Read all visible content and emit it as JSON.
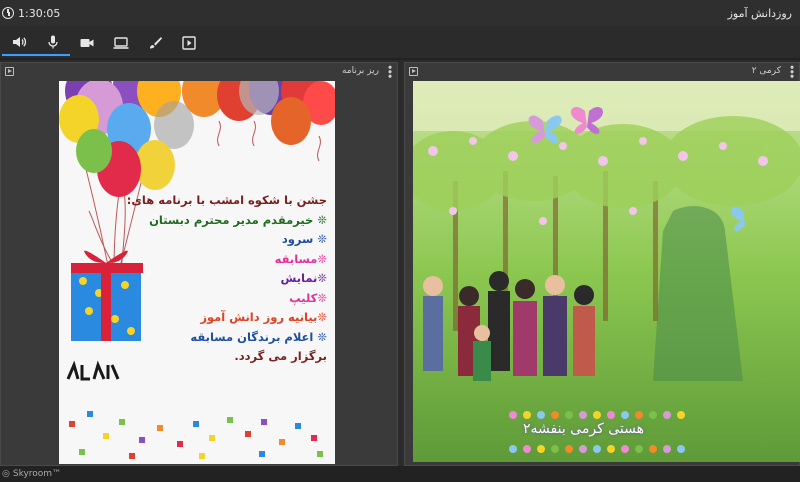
{
  "titlebar": {
    "timer": "1:30:05",
    "app_title": "روزدانش آموز"
  },
  "panels": {
    "left": {
      "title": "ریز برنامه"
    },
    "right": {
      "title": "کرمی ۲"
    }
  },
  "program": {
    "lines": [
      {
        "text": "جشن با شکوه امشب با برنامه های:",
        "color": "#7a1f1f"
      },
      {
        "text": "❊ خیرمقدم مدیر محترم دبستان",
        "color": "#1f6a1f"
      },
      {
        "text": "❊ سرود",
        "color": "#1f4fa0"
      },
      {
        "text": "❊مسابقه",
        "color": "#e0339a"
      },
      {
        "text": "❊نمایش",
        "color": "#6a1fa0"
      },
      {
        "text": "❊کلیپ",
        "color": "#e0339a"
      },
      {
        "text": "❊بیانیه روز دانش آموز",
        "color": "#e2401f"
      },
      {
        "text": "❊ اعلام برندگان مسابقه",
        "color": "#1f4fa0"
      },
      {
        "text": "برگزار می گردد.",
        "color": "#7a1f1f"
      }
    ]
  },
  "video": {
    "caption": "هستی کرمی بنفشه۲"
  },
  "footer": {
    "brand": "Skyroom™"
  },
  "colors": {
    "accent": "#3aa0ff",
    "background": "#2b2b2b"
  },
  "icons": [
    "speaker-icon",
    "microphone-icon",
    "camera-icon",
    "screen-share-icon",
    "brush-icon",
    "play-file-icon",
    "clock-icon"
  ]
}
